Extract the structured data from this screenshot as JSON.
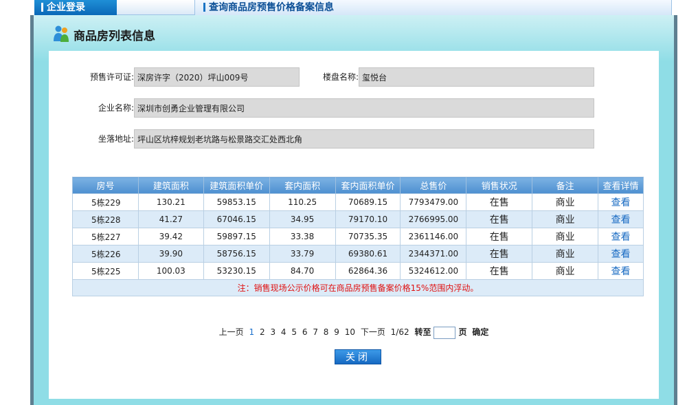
{
  "topbar": {
    "login_tab": "企业登录",
    "query_tab": "查询商品房预售价格备案信息"
  },
  "dialog": {
    "title": "商品房列表信息",
    "presale_label": "预售许可证:",
    "presale_value": "深房许字（2020）坪山009号",
    "project_label": "楼盘名称:",
    "project_value": "玺悦台",
    "company_label": "企业名称:",
    "company_value": "深圳市创勇企业管理有限公司",
    "address_label": "坐落地址:",
    "address_value": "坪山区坑梓规划老坑路与松景路交汇处西北角"
  },
  "table": {
    "headers": [
      "房号",
      "建筑面积",
      "建筑面积单价",
      "套内面积",
      "套内面积单价",
      "总售价",
      "销售状况",
      "备注",
      "查看详情"
    ],
    "rows": [
      [
        "5栋229",
        "130.21",
        "59853.15",
        "110.25",
        "70689.15",
        "7793479.00",
        "在售",
        "商业",
        "查看"
      ],
      [
        "5栋228",
        "41.27",
        "67046.15",
        "34.95",
        "79170.10",
        "2766995.00",
        "在售",
        "商业",
        "查看"
      ],
      [
        "5栋227",
        "39.42",
        "59897.15",
        "33.38",
        "70735.35",
        "2361146.00",
        "在售",
        "商业",
        "查看"
      ],
      [
        "5栋226",
        "39.90",
        "58756.15",
        "33.79",
        "69380.61",
        "2344371.00",
        "在售",
        "商业",
        "查看"
      ],
      [
        "5栋225",
        "100.03",
        "53230.15",
        "84.70",
        "62864.36",
        "5324612.00",
        "在售",
        "商业",
        "查看"
      ]
    ],
    "note": "注：销售现场公示价格可在商品房预售备案价格15%范围内浮动。"
  },
  "pager": {
    "prev": "上一页",
    "pages": [
      "1",
      "2",
      "3",
      "4",
      "5",
      "6",
      "7",
      "8",
      "9",
      "10"
    ],
    "current": "1",
    "next": "下一页",
    "total": "1/62",
    "goto_label": "转至",
    "page_unit": "页",
    "confirm": "确定"
  },
  "close_button": "关闭"
}
